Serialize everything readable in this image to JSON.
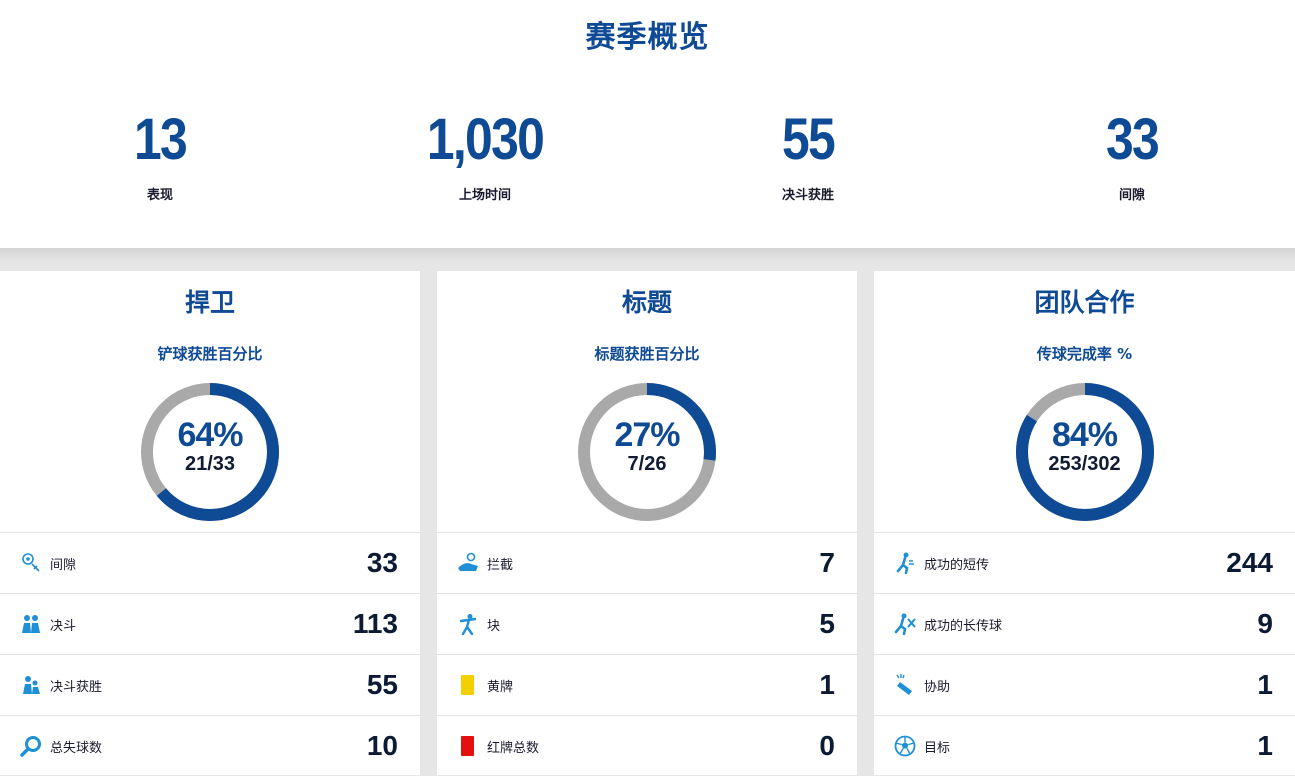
{
  "page": {
    "title": "赛季概览"
  },
  "summary": [
    {
      "value": "13",
      "label": "表现"
    },
    {
      "value": "1,030",
      "label": "上场时间"
    },
    {
      "value": "55",
      "label": "决斗获胜"
    },
    {
      "value": "33",
      "label": "间隙"
    }
  ],
  "panels": [
    {
      "title": "捍卫",
      "subtitle": "铲球获胜百分比",
      "donut": {
        "percent_text": "64%",
        "fraction_text": "21/33",
        "percent": 64
      },
      "rows": [
        {
          "icon": "clearance-icon",
          "label": "间隙",
          "value": "33"
        },
        {
          "icon": "duel-icon",
          "label": "决斗",
          "value": "113"
        },
        {
          "icon": "duel-won-icon",
          "label": "决斗获胜",
          "value": "55"
        },
        {
          "icon": "goals-conceded-icon",
          "label": "总失球数",
          "value": "10"
        }
      ]
    },
    {
      "title": "标题",
      "subtitle": "标题获胜百分比",
      "donut": {
        "percent_text": "27%",
        "fraction_text": "7/26",
        "percent": 27
      },
      "rows": [
        {
          "icon": "interception-icon",
          "label": "拦截",
          "value": "7"
        },
        {
          "icon": "block-icon",
          "label": "块",
          "value": "5"
        },
        {
          "icon": "yellow-card-icon",
          "label": "黄牌",
          "value": "1"
        },
        {
          "icon": "red-card-icon",
          "label": "红牌总数",
          "value": "0"
        }
      ]
    },
    {
      "title": "团队合作",
      "subtitle": "传球完成率 %",
      "donut": {
        "percent_text": "84%",
        "fraction_text": "253/302",
        "percent": 84
      },
      "rows": [
        {
          "icon": "short-pass-icon",
          "label": "成功的短传",
          "value": "244"
        },
        {
          "icon": "long-pass-icon",
          "label": "成功的长传球",
          "value": "9"
        },
        {
          "icon": "assist-icon",
          "label": "协助",
          "value": "1"
        },
        {
          "icon": "goal-icon",
          "label": "目标",
          "value": "1"
        }
      ]
    }
  ],
  "colors": {
    "brand_blue": "#0f4a95",
    "icon_blue": "#1f8fd6",
    "ring_gray": "#a9a9a9",
    "yellow_card": "#f5d000",
    "red_card": "#e41010"
  }
}
